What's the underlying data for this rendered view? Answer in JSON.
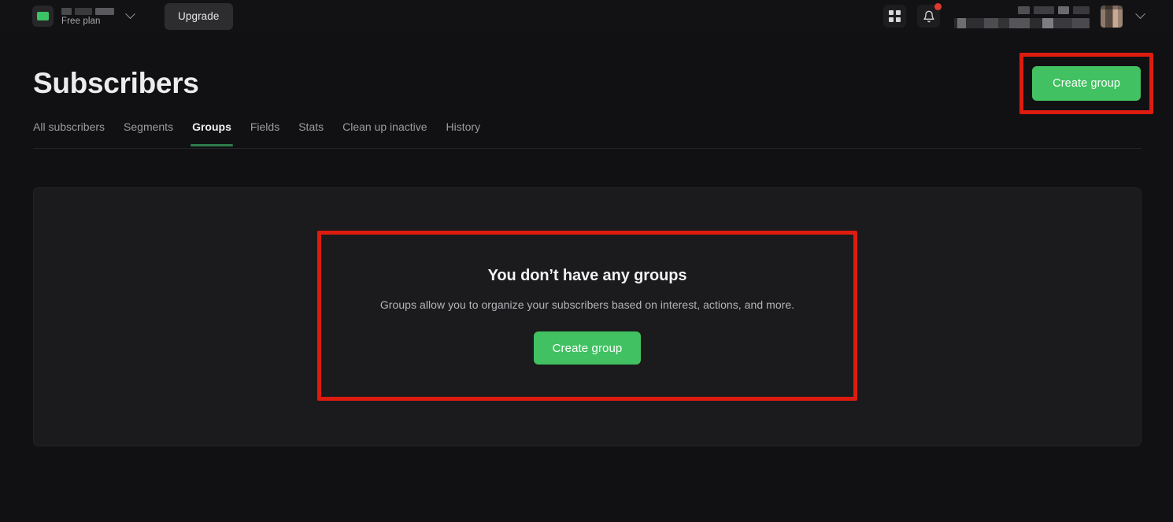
{
  "topbar": {
    "brand": {
      "logo_icon": "mailerlite-logo-icon"
    },
    "account": {
      "name_redacted": true,
      "plan_label": "Free plan",
      "switcher_icon": "chevron-down-icon"
    },
    "upgrade_label": "Upgrade",
    "apps_icon": "grid-apps-icon",
    "notifications_icon": "bell-icon",
    "notifications_has_badge": true,
    "user": {
      "name_redacted": true,
      "email_redacted": true,
      "avatar_icon": "user-avatar",
      "menu_icon": "chevron-down-icon"
    }
  },
  "page": {
    "title": "Subscribers",
    "header_action_label": "Create group"
  },
  "tabs": [
    {
      "label": "All subscribers",
      "active": false
    },
    {
      "label": "Segments",
      "active": false
    },
    {
      "label": "Groups",
      "active": true
    },
    {
      "label": "Fields",
      "active": false
    },
    {
      "label": "Stats",
      "active": false
    },
    {
      "label": "Clean up inactive",
      "active": false
    },
    {
      "label": "History",
      "active": false
    }
  ],
  "empty_state": {
    "title": "You don’t have any groups",
    "description": "Groups allow you to organize your subscribers based on interest, actions, and more.",
    "button_label": "Create group"
  },
  "colors": {
    "accent_green": "#41c161",
    "active_tab_underline": "#2f7d4d",
    "annotation_red": "#dd1c10",
    "page_background": "#111113",
    "card_background": "#1b1b1d",
    "notification_badge": "#e03a2f"
  }
}
